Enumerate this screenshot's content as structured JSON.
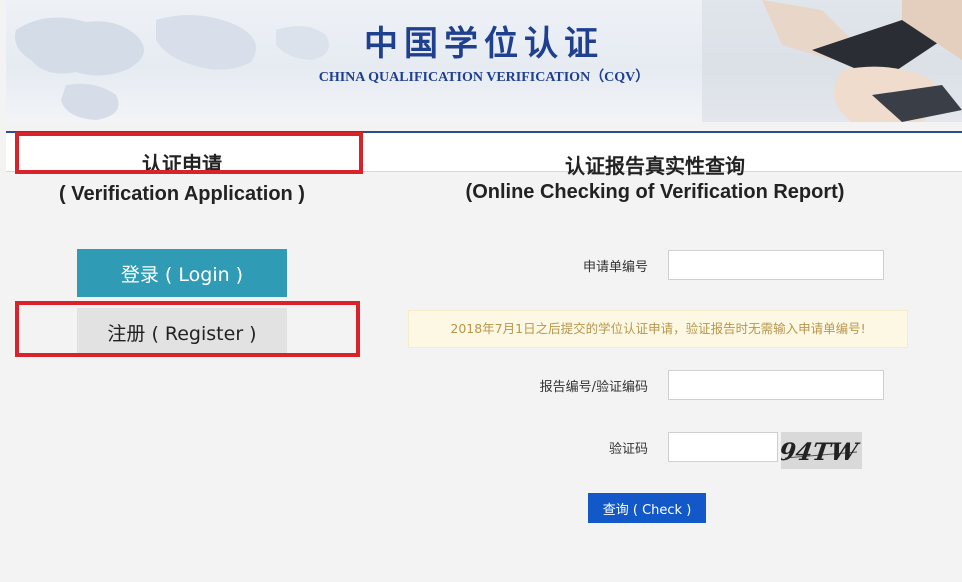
{
  "header": {
    "title": "中国学位认证",
    "subtitle": "CHINA QUALIFICATION VERIFICATION（CQV）"
  },
  "left_panel": {
    "title": "认证申请",
    "subtitle": "( Verification Application )",
    "login_label": "登录 ( Login )",
    "register_label": "注册 ( Register )"
  },
  "right_panel": {
    "title": "认证报告真实性查询",
    "subtitle": "(Online Checking of Verification Report)",
    "application_no_label": "申请单编号",
    "application_no_value": "",
    "notice": "2018年7月1日之后提交的学位认证申请，验证报告时无需输入申请单编号!",
    "report_no_label": "报告编号/验证编码",
    "report_no_value": "",
    "captcha_label": "验证码",
    "captcha_value": "",
    "captcha_image_text": "94TW",
    "check_label": "查询 ( Check )"
  },
  "colors": {
    "login_button": "#2f9bb5",
    "register_button": "#e2e2e2",
    "check_button": "#1258c8",
    "annotation": "#d8232a",
    "title_blue": "#1f3f8f",
    "notice_text": "#b8964c"
  }
}
